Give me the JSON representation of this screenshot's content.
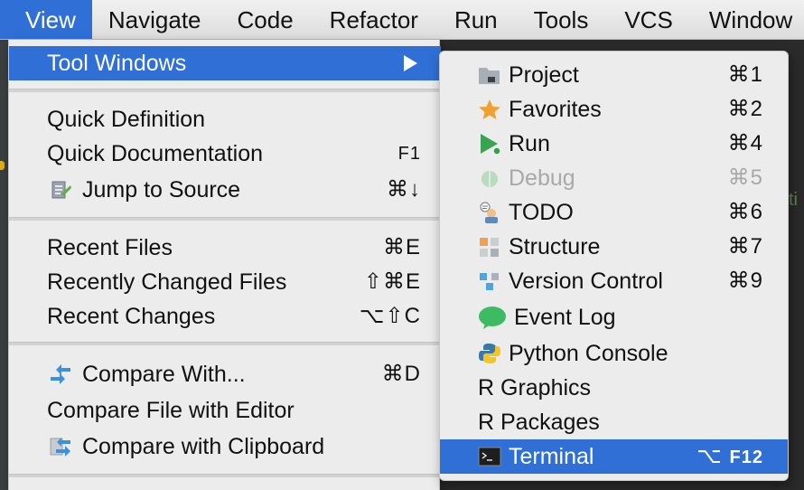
{
  "menubar": {
    "items": [
      "View",
      "Navigate",
      "Code",
      "Refactor",
      "Run",
      "Tools",
      "VCS",
      "Window"
    ]
  },
  "view_menu": {
    "tool_windows": "Tool Windows",
    "quick_definition": "Quick Definition",
    "quick_documentation": "Quick Documentation",
    "quick_documentation_sc": "F1",
    "jump_to_source": "Jump to Source",
    "jump_to_source_sc": "⌘↓",
    "recent_files": "Recent Files",
    "recent_files_sc": "⌘E",
    "recently_changed_files": "Recently Changed Files",
    "recently_changed_files_sc": "⇧⌘E",
    "recent_changes": "Recent Changes",
    "recent_changes_sc": "⌥⇧C",
    "compare_with": "Compare With...",
    "compare_with_sc": "⌘D",
    "compare_file_with_editor": "Compare File with Editor",
    "compare_with_clipboard": "Compare with Clipboard"
  },
  "tool_windows_submenu": [
    {
      "label": "Project",
      "shortcut": "⌘1",
      "icon": "folder-icon"
    },
    {
      "label": "Favorites",
      "shortcut": "⌘2",
      "icon": "star-icon"
    },
    {
      "label": "Run",
      "shortcut": "⌘4",
      "icon": "run-icon"
    },
    {
      "label": "Debug",
      "shortcut": "⌘5",
      "icon": "bug-icon",
      "disabled": true
    },
    {
      "label": "TODO",
      "shortcut": "⌘6",
      "icon": "todo-icon"
    },
    {
      "label": "Structure",
      "shortcut": "⌘7",
      "icon": "structure-icon"
    },
    {
      "label": "Version Control",
      "shortcut": "⌘9",
      "icon": "version-control-icon"
    },
    {
      "label": "Event Log",
      "shortcut": "",
      "icon": "event-log-icon"
    },
    {
      "label": "Python Console",
      "shortcut": "",
      "icon": "python-icon"
    },
    {
      "label": "R Graphics",
      "shortcut": "",
      "icon": ""
    },
    {
      "label": "R Packages",
      "shortcut": "",
      "icon": ""
    },
    {
      "label": "Terminal",
      "shortcut_mod": "⌥",
      "shortcut_key": "F12",
      "icon": "terminal-icon"
    }
  ],
  "colors": {
    "highlight": "#2f6fd6",
    "menu_bg": "#ececec",
    "disabled_text": "#a9a9a9"
  }
}
